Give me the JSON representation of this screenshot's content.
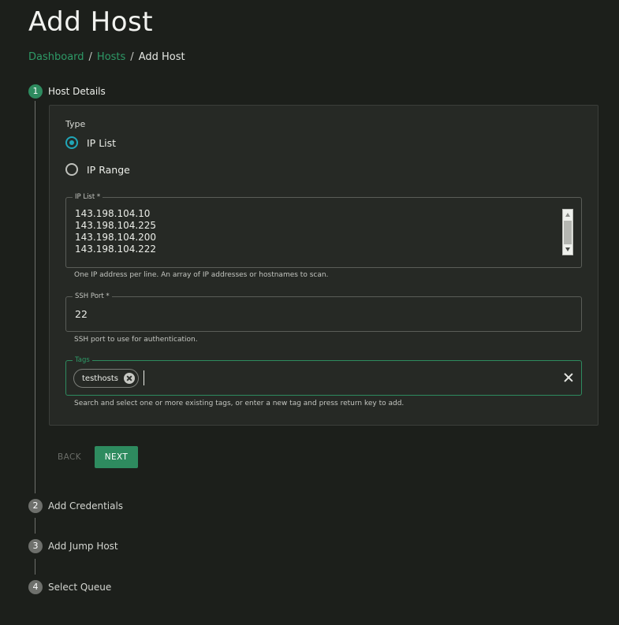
{
  "header": {
    "title": "Add Host"
  },
  "breadcrumb": {
    "items": [
      "Dashboard",
      "Hosts"
    ],
    "separator": "/",
    "current": "Add Host"
  },
  "steps": [
    {
      "number": "1",
      "label": "Host Details",
      "active": true
    },
    {
      "number": "2",
      "label": "Add Credentials",
      "active": false
    },
    {
      "number": "3",
      "label": "Add Jump Host",
      "active": false
    },
    {
      "number": "4",
      "label": "Select Queue",
      "active": false
    }
  ],
  "form": {
    "type": {
      "label": "Type",
      "options": [
        "IP List",
        "IP Range"
      ],
      "selected": "IP List"
    },
    "ip_list": {
      "label": "IP List *",
      "values": [
        "143.198.104.10",
        "143.198.104.225",
        "143.198.104.200",
        "143.198.104.222"
      ],
      "helper": "One IP address per line. An array of IP addresses or hostnames to scan."
    },
    "ssh_port": {
      "label": "SSH Port *",
      "value": "22",
      "helper": "SSH port to use for authentication."
    },
    "tags": {
      "label": "Tags",
      "chips": [
        "testhosts"
      ],
      "helper": "Search and select one or more existing tags, or enter a new tag and press return key to add."
    }
  },
  "actions": {
    "back_label": "BACK",
    "next_label": "NEXT"
  },
  "colors": {
    "accent": "#2e8b5f",
    "radio": "#20a6b8",
    "background": "#1c1f1b"
  }
}
